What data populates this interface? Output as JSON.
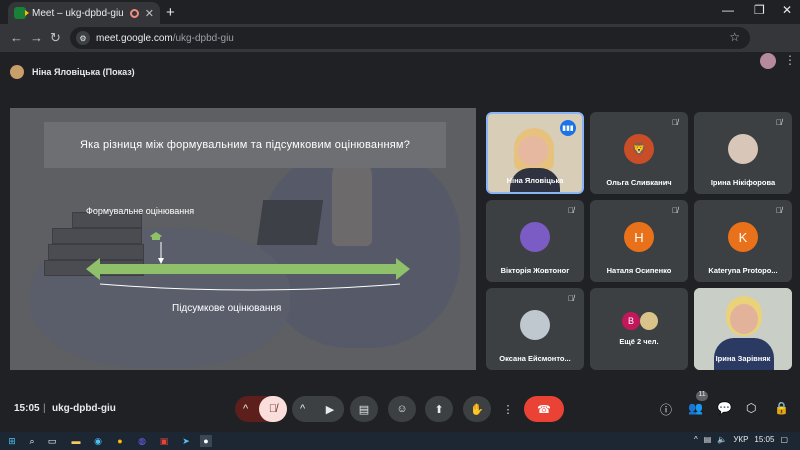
{
  "browser": {
    "tab_title": "Meet – ukg-dpbd-giu",
    "new_tab": "+",
    "url_host": "meet.google.com",
    "url_path": "/ukg-dpbd-giu"
  },
  "presenter_bar": {
    "label": "Ніна Яловіцька (Показ)"
  },
  "slide": {
    "question": "Яка різниця між формувальним та підсумковим оцінюванням?",
    "label_formative": "Формувальне оцінювання",
    "label_summative": "Підсумкове оцінювання",
    "arrow_color": "#8fc16b"
  },
  "participants": [
    {
      "name": "Ніна Яловіцька",
      "type": "video",
      "speaking": true
    },
    {
      "name": "Ольга Сливканич",
      "type": "photo",
      "muted": true
    },
    {
      "name": "Ірина Нікіфорова",
      "type": "photo",
      "muted": true
    },
    {
      "name": "Вікторія Жовтоног",
      "type": "photo",
      "muted": true
    },
    {
      "name": "Наталя Осипенко",
      "type": "letter",
      "letter": "Н",
      "color": "#e8711a",
      "muted": true
    },
    {
      "name": "Kateryna Protopo...",
      "type": "letter",
      "letter": "K",
      "color": "#e8711a",
      "muted": true
    },
    {
      "name": "Оксана Ейсмонто...",
      "type": "photo",
      "muted": true
    },
    {
      "name": "Ещё 2 чел.",
      "type": "group",
      "letter": "В",
      "color": "#c2185b"
    },
    {
      "name": "Ірина Зарівняк",
      "type": "video"
    }
  ],
  "meeting": {
    "time": "15:05",
    "separator": "|",
    "code": "ukg-dpbd-giu",
    "participants_count": "11"
  },
  "colors": {
    "end_call": "#ea4335",
    "mic_off_bg": "#f9dedc",
    "speaking": "#1a73e8"
  },
  "taskbar": {
    "lang": "УКР",
    "time": "15:05"
  }
}
